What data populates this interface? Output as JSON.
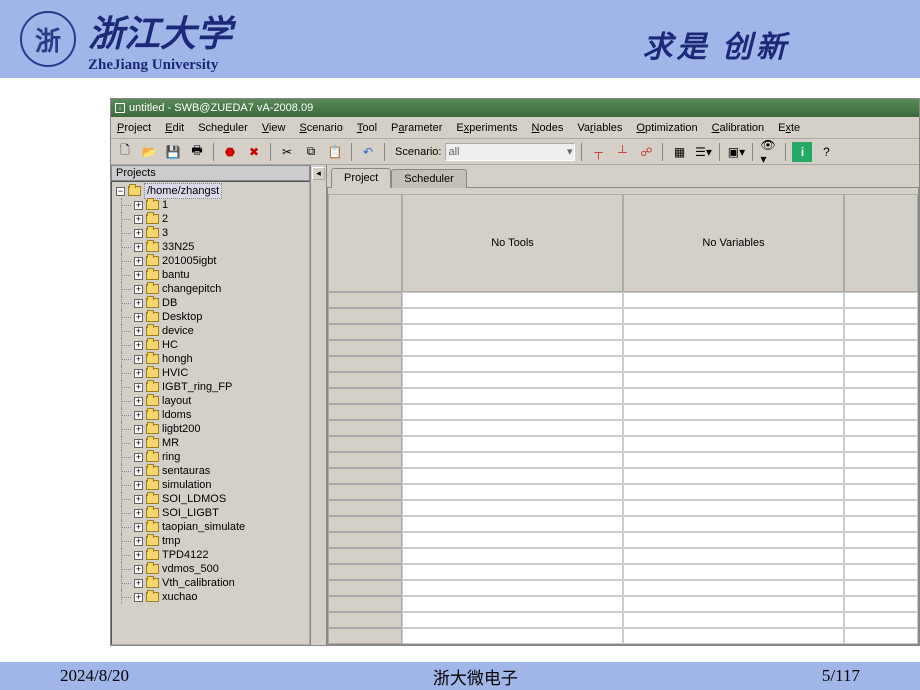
{
  "header": {
    "university_cn": "浙江大学",
    "university_en": "ZheJiang University",
    "motto": "求是  创新"
  },
  "app": {
    "title": "untitled - SWB@ZUEDA7 vA-2008.09",
    "menus": [
      "Project",
      "Edit",
      "Scheduler",
      "View",
      "Scenario",
      "Tool",
      "Parameter",
      "Experiments",
      "Nodes",
      "Variables",
      "Optimization",
      "Calibration",
      "Exte"
    ],
    "scenario_label": "Scenario:",
    "scenario_value": "all",
    "left_pane_title": "Projects",
    "tree_root": "/home/zhangst",
    "tree_items": [
      "1",
      "2",
      "3",
      "33N25",
      "201005igbt",
      "bantu",
      "changepitch",
      "DB",
      "Desktop",
      "device",
      "HC",
      "hongh",
      "HVIC",
      "IGBT_ring_FP",
      "layout",
      "ldoms",
      "ligbt200",
      "MR",
      "ring",
      "sentauras",
      "simulation",
      "SOI_LDMOS",
      "SOI_LIGBT",
      "taopian_simulate",
      "tmp",
      "TPD4122",
      "vdmos_500",
      "Vth_calibration",
      "xuchao"
    ],
    "tabs": {
      "project": "Project",
      "scheduler": "Scheduler"
    },
    "grid": {
      "no_tools": "No Tools",
      "no_variables": "No Variables"
    }
  },
  "footer": {
    "date": "2024/8/20",
    "center": "浙大微电子",
    "page": "5/117"
  }
}
